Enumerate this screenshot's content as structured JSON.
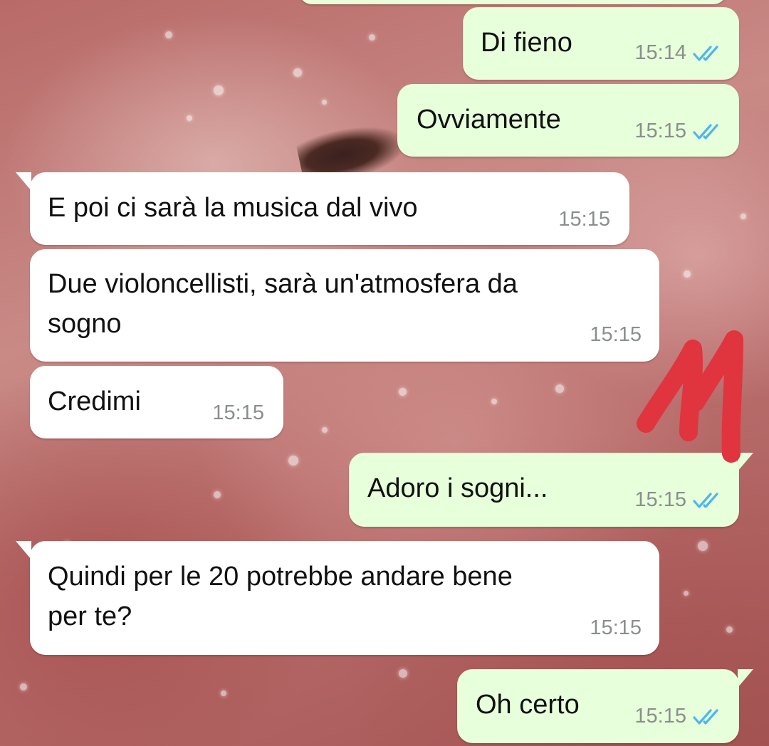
{
  "colors": {
    "outgoing_bubble": "#e7ffdb",
    "incoming_bubble": "#ffffff",
    "read_ticks": "#4fb6ec",
    "timestamp": "#8a8f8c",
    "sticker": "#e0343e"
  },
  "messages": [
    {
      "direction": "outgoing",
      "text": "Di fieno",
      "time": "15:14",
      "status_icon": "double-check-read-icon"
    },
    {
      "direction": "outgoing",
      "text": "Ovviamente",
      "time": "15:15",
      "status_icon": "double-check-read-icon"
    },
    {
      "direction": "incoming",
      "text": "E poi ci sarà la musica dal vivo",
      "time": "15:15"
    },
    {
      "direction": "incoming",
      "text_line1": "Due violoncellisti, sarà un'atmosfera da",
      "text_line2": "sogno",
      "time": "15:15"
    },
    {
      "direction": "incoming",
      "text": "Credimi",
      "time": "15:15"
    },
    {
      "direction": "outgoing",
      "text": "Adoro i sogni...",
      "time": "15:15",
      "status_icon": "double-check-read-icon"
    },
    {
      "direction": "incoming",
      "text_line1": "Quindi per le 20 potrebbe andare bene",
      "text_line2": "per te?",
      "time": "15:15"
    },
    {
      "direction": "outgoing",
      "text": "Oh certo",
      "time": "15:15",
      "status_icon": "double-check-read-icon"
    }
  ],
  "sticker": {
    "icon": "number-11-sticker"
  }
}
